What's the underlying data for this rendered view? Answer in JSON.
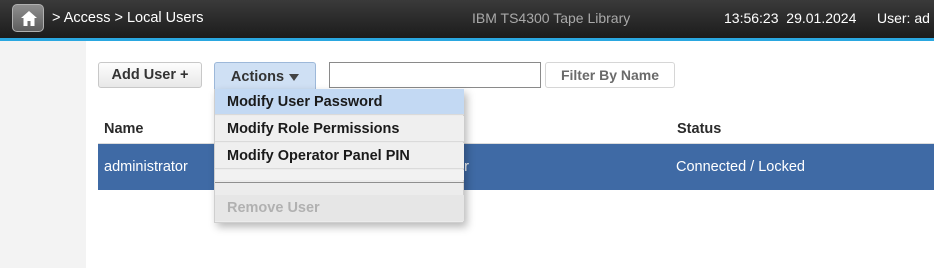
{
  "header": {
    "breadcrumb": [
      ">",
      "Access",
      ">",
      "Local Users"
    ],
    "product": "IBM TS4300 Tape Library",
    "time": "13:56:23",
    "date": "29.01.2024",
    "user_label": "User: ad"
  },
  "toolbar": {
    "add_user_label": "Add User +",
    "actions_label": "Actions",
    "filter_value": "",
    "filter_button_label": "Filter By Name"
  },
  "actions_menu": {
    "items": [
      "Modify User Password",
      "Modify Role Permissions",
      "Modify Operator Panel PIN"
    ],
    "remove_label": "Remove User"
  },
  "table": {
    "headers": [
      "Name",
      "Status"
    ],
    "rows": [
      {
        "name": "administrator",
        "role_visible": "tor",
        "status": "Connected / Locked"
      }
    ]
  },
  "colors": {
    "accent": "#2aa7e0",
    "selected_row": "#3f6aa5",
    "menu_highlight": "#c3d9f3"
  },
  "icons": [
    "home-icon",
    "caret-down-icon"
  ]
}
